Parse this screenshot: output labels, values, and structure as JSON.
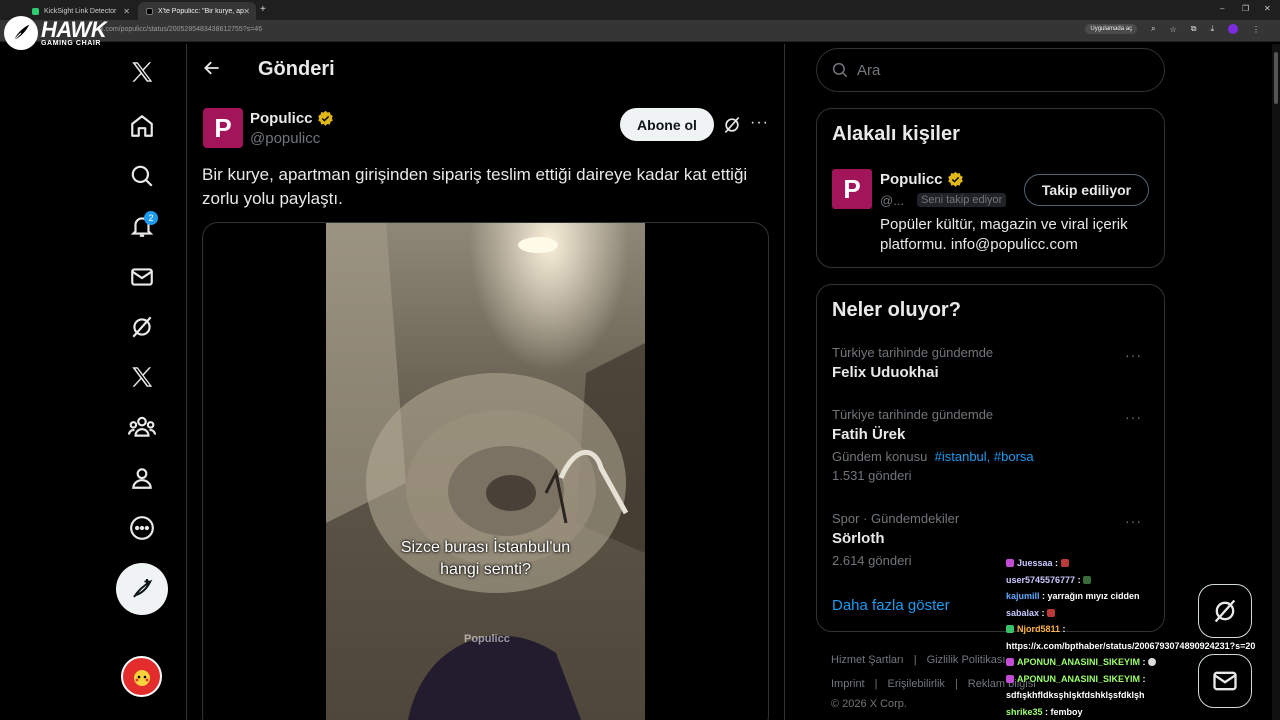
{
  "browser": {
    "tabs": [
      {
        "title": "KickSight Link Detector",
        "active": false
      },
      {
        "title": "X'te Populicc: \"Bir kurye, apartm",
        "active": true
      }
    ],
    "new_tab": "+",
    "url": "x.com/populicc/status/2005285483438612755?s=46",
    "app_pill": "Uygulamada aç",
    "win_min": "–",
    "win_max": "❐",
    "win_close": "✕"
  },
  "watermark": {
    "name": "HAWK",
    "sub": "GAMING CHAIR"
  },
  "nav": {
    "items": [
      {
        "name": "x-logo-icon"
      },
      {
        "name": "home-icon"
      },
      {
        "name": "search-icon"
      },
      {
        "name": "bell-icon",
        "badge": "2"
      },
      {
        "name": "mail-icon"
      },
      {
        "name": "grok-icon"
      },
      {
        "name": "x-premium-icon"
      },
      {
        "name": "communities-icon"
      },
      {
        "name": "profile-icon"
      },
      {
        "name": "more-circle-icon"
      }
    ]
  },
  "post": {
    "page_title": "Gönderi",
    "author_name": "Populicc",
    "author_handle": "@populicc",
    "avatar_letter": "P",
    "subscribe_label": "Abone ol",
    "more": "···",
    "text": "Bir kurye, apartman girişinden sipariş teslim ettiği daireye kadar kat ettiği zorlu yolu paylaştı.",
    "video_caption_line1": "Sizce burası İstanbul'un",
    "video_caption_line2": "hangi semti?",
    "video_watermark": "Populicc"
  },
  "search": {
    "placeholder": "Ara"
  },
  "related": {
    "title": "Alakalı kişiler",
    "name": "Populicc",
    "handle": "@...",
    "follows_you": "Seni takip ediyor",
    "following_label": "Takip ediliyor",
    "bio": "Popüler kültür, magazin ve viral içerik platformu. info@populicc.com"
  },
  "trends": {
    "title": "Neler oluyor?",
    "items": [
      {
        "context": "Türkiye tarihinde gündemde",
        "name": "Felix Uduokhai"
      },
      {
        "context": "Türkiye tarihinde gündemde",
        "name": "Fatih Ürek",
        "topic_prefix": "Gündem konusu",
        "topic_links": "#istanbul, #borsa",
        "count": "1.531 gönderi"
      },
      {
        "context": "Spor · Gündemdekiler",
        "name": "Sörloth",
        "count": "2.614 gönderi"
      }
    ],
    "more_label": "···",
    "show_more": "Daha fazla göster"
  },
  "footer": {
    "row1": [
      "Hizmet Şartları",
      "Gizlilik Politikası"
    ],
    "row2": [
      "Imprint",
      "Erişilebilirlik",
      "Reklam bilgisi"
    ],
    "copyright": "© 2026 X Corp."
  },
  "chat": [
    {
      "user": "Juessaa",
      "msg": "",
      "color": "#c9c9ff",
      "icon": "#c34bd8"
    },
    {
      "user": "user5745576777",
      "msg": "",
      "color": "#c9c9ff",
      "icon": ""
    },
    {
      "user": "kajumill",
      "msg": "yarrağın mıyız cidden",
      "color": "#5fa8ff",
      "icon": ""
    },
    {
      "user": "sabalax",
      "msg": "",
      "color": "#c9c9ff",
      "icon": ""
    },
    {
      "user": "Njord5811",
      "msg": "",
      "color": "#ffb347",
      "icon": "#3ac26a"
    },
    {
      "user": "",
      "msg": "https://x.com/bpthaber/status/2006793074890924231?s=20",
      "color": "#fff",
      "icon": ""
    },
    {
      "user": "APONUN_ANASINI_SIKEYIM",
      "msg": "",
      "color": "#9dff6b",
      "icon": "#c34bd8"
    },
    {
      "user": "APONUN_ANASINI_SIKEYIM",
      "msg": "",
      "color": "#9dff6b",
      "icon": "#c34bd8"
    },
    {
      "user": "",
      "msg": "sdfışkhfldksşhlşkfdshklşsfdklşh",
      "color": "#fff",
      "icon": ""
    },
    {
      "user": "shrike35",
      "msg": "femboy",
      "color": "#9dff6b",
      "icon": ""
    }
  ],
  "colors": {
    "accent": "#1d9bf0",
    "brand_avatar": "#a2155a",
    "verified": "#e2b719"
  }
}
